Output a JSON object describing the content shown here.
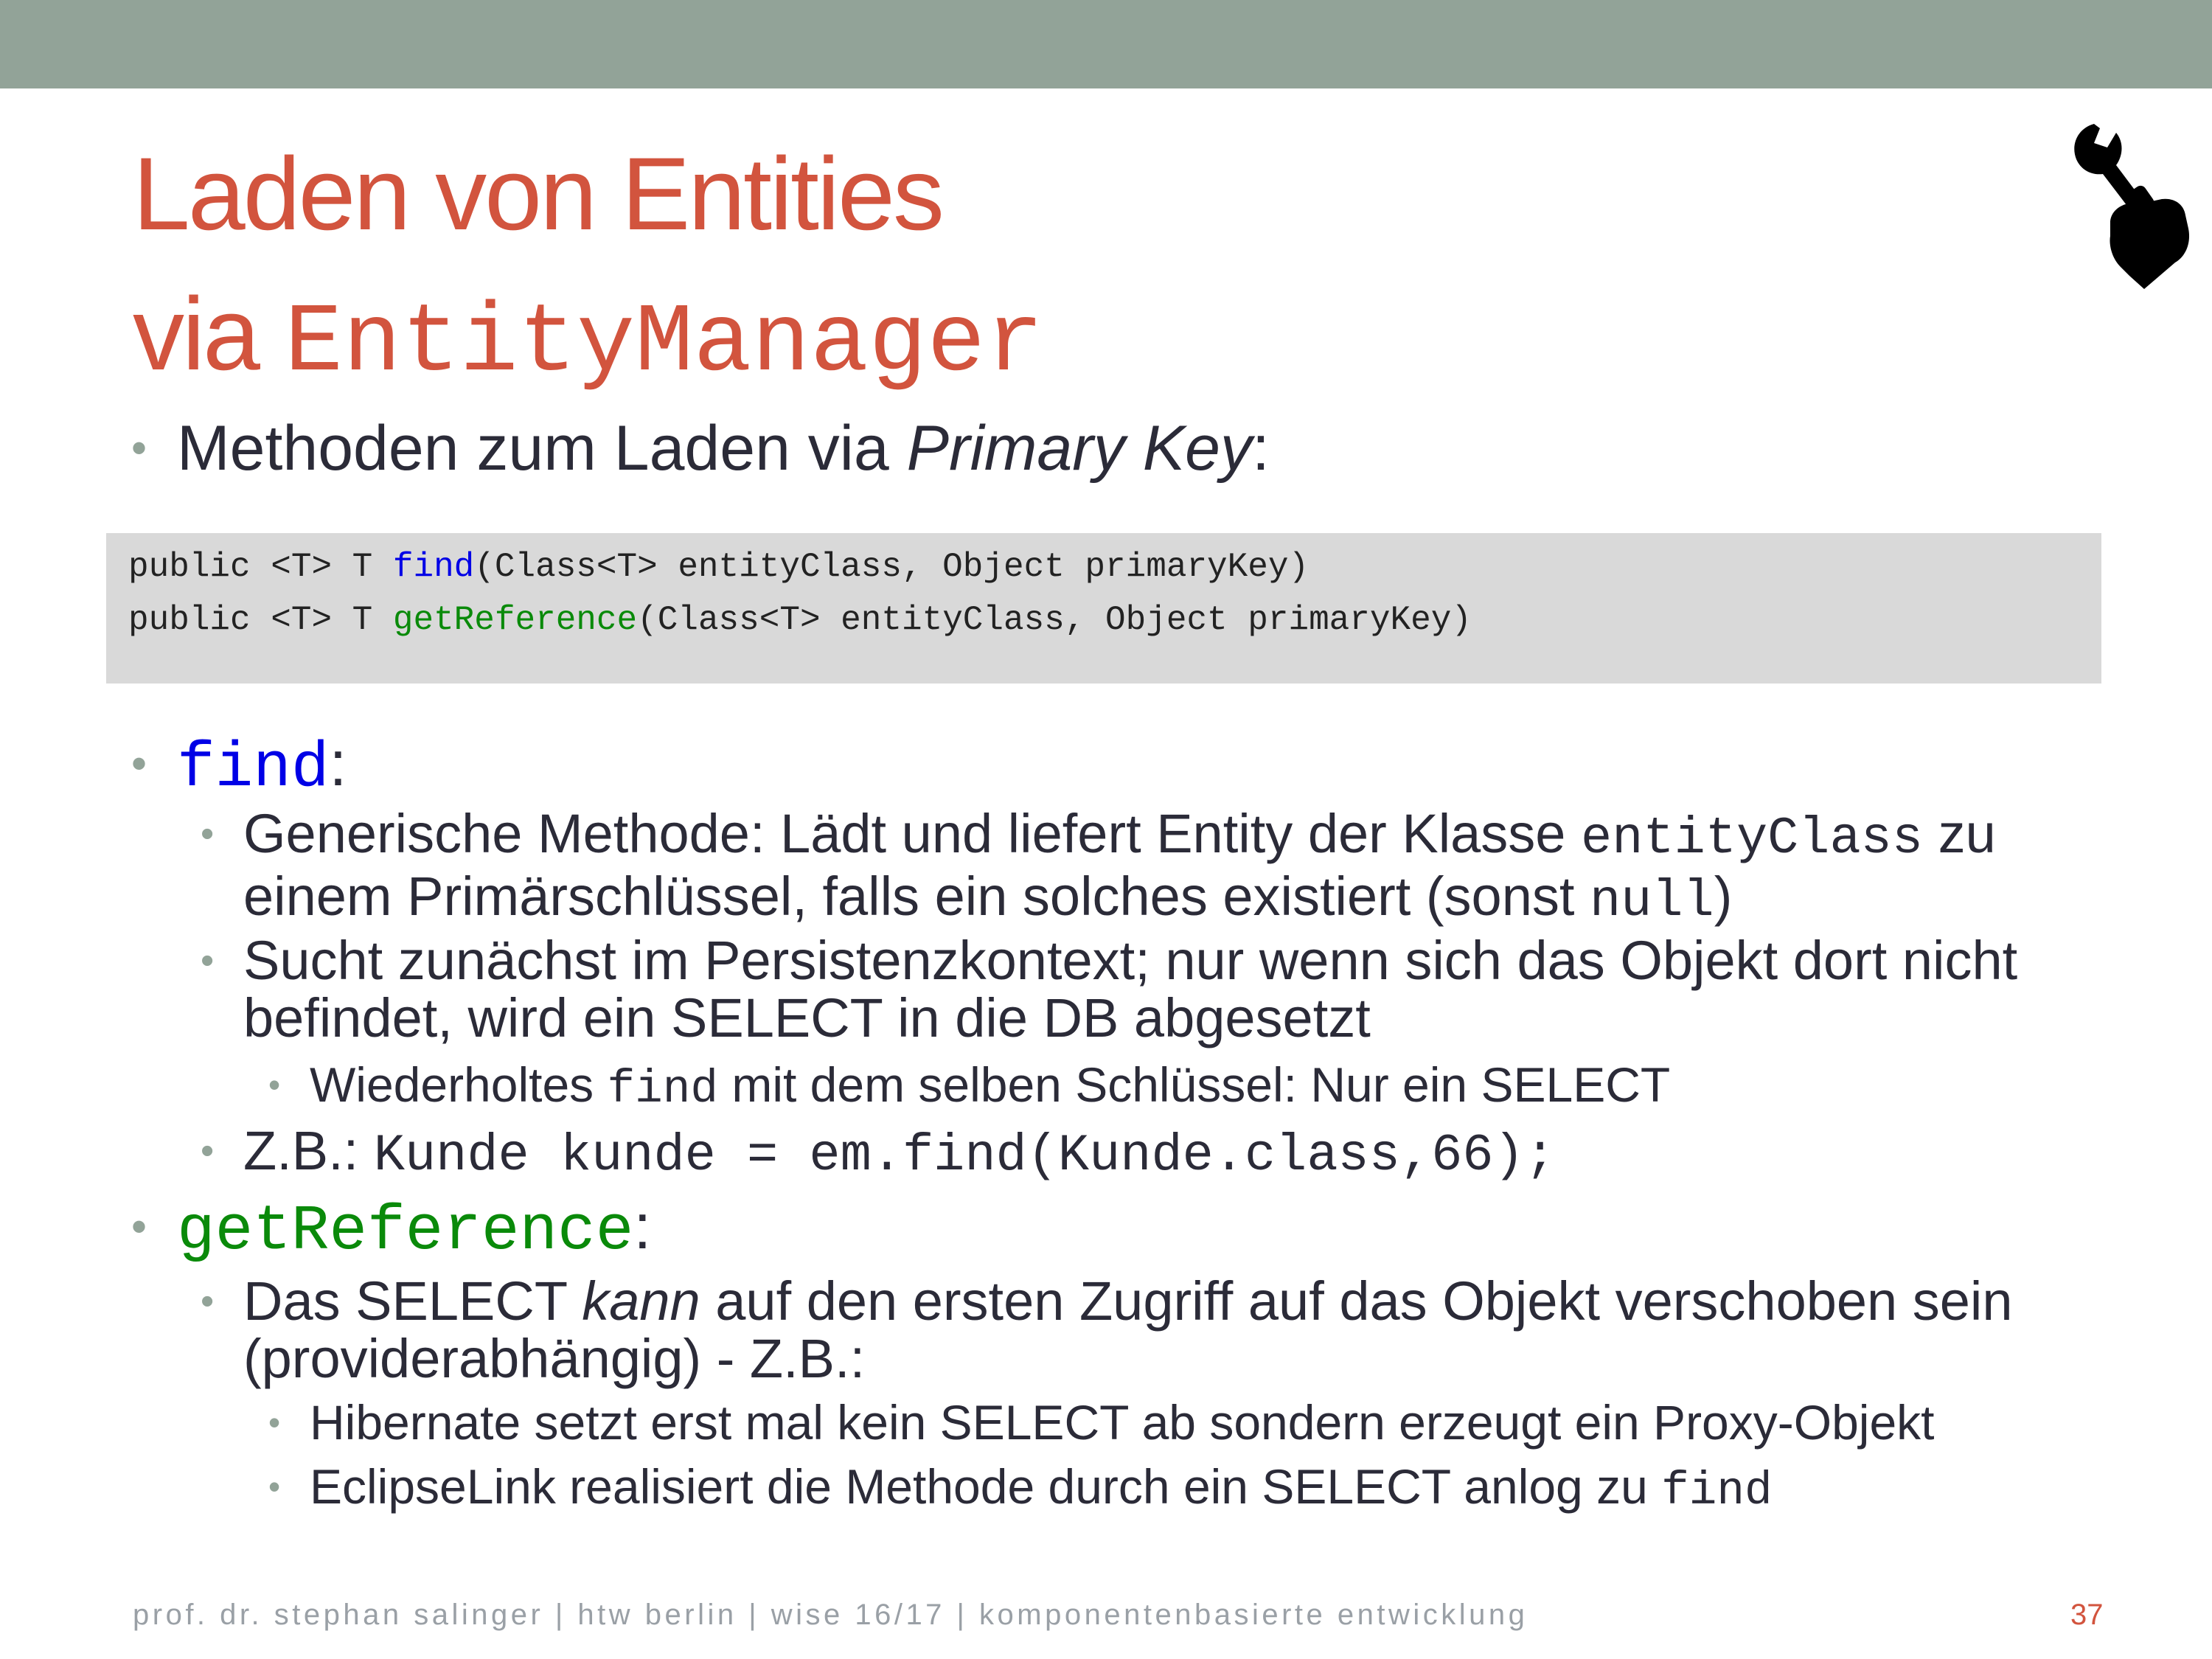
{
  "title": {
    "line1": "Laden von Entities",
    "line2_prefix": "via ",
    "line2_code": "EntityManager"
  },
  "icon": "hand-holding-wrench-icon",
  "bullet_primary_key": {
    "prefix": "Methoden zum Laden via ",
    "italic": "Primary Key",
    "suffix": ":"
  },
  "code": {
    "line1": {
      "before": "public <T> T ",
      "method": "find",
      "after": "(Class<T> entityClass, Object primaryKey)"
    },
    "line2": {
      "before": "public <T> T ",
      "method": "getReference",
      "after": "(Class<T> entityClass, Object primaryKey)"
    }
  },
  "find_section": {
    "heading_code": "find",
    "heading_suffix": ":",
    "item1": {
      "line1_text": "Generische Methode: Lädt und liefert Entity der Klasse ",
      "line1_code": "entityClass",
      "line1_after": " zu",
      "line2_text": "einem Primärschlüssel, falls ein solches existiert (sonst ",
      "line2_code": "null",
      "line2_after": ")"
    },
    "item2": {
      "line1": "Sucht zunächst im Persistenzkontext; nur wenn sich das Objekt dort nicht",
      "line2": "befindet, wird ein SELECT in die DB abgesetzt"
    },
    "item2_sub": {
      "before": "Wiederholtes ",
      "code": "find",
      "after": " mit dem selben Schlüssel: Nur ein SELECT"
    },
    "item3": {
      "prefix": "Z.B.: ",
      "code": "Kunde kunde = em.find(Kunde.class,66);"
    }
  },
  "getreference_section": {
    "heading_code": "getReference",
    "heading_suffix": ":",
    "item1": {
      "line1_before": "Das SELECT ",
      "line1_italic": "kann",
      "line1_after": " auf den ersten Zugriff auf das Objekt verschoben sein",
      "line2": "(providerabhängig) - Z.B.:"
    },
    "sub1": "Hibernate setzt erst mal kein SELECT ab sondern erzeugt ein Proxy-Objekt",
    "sub2": {
      "before": "EclipseLink realisiert die Methode durch ein SELECT anlog zu ",
      "code": "find"
    }
  },
  "footer": "prof. dr. stephan salinger | htw berlin | wise 16/17 | komponentenbasierte entwicklung",
  "page_number": "37",
  "colors": {
    "topbar": "#92a398",
    "title": "#d2543e",
    "find_blue": "#0000e6",
    "getreference_green": "#0a8a0a",
    "code_background": "#d9d9d9"
  }
}
